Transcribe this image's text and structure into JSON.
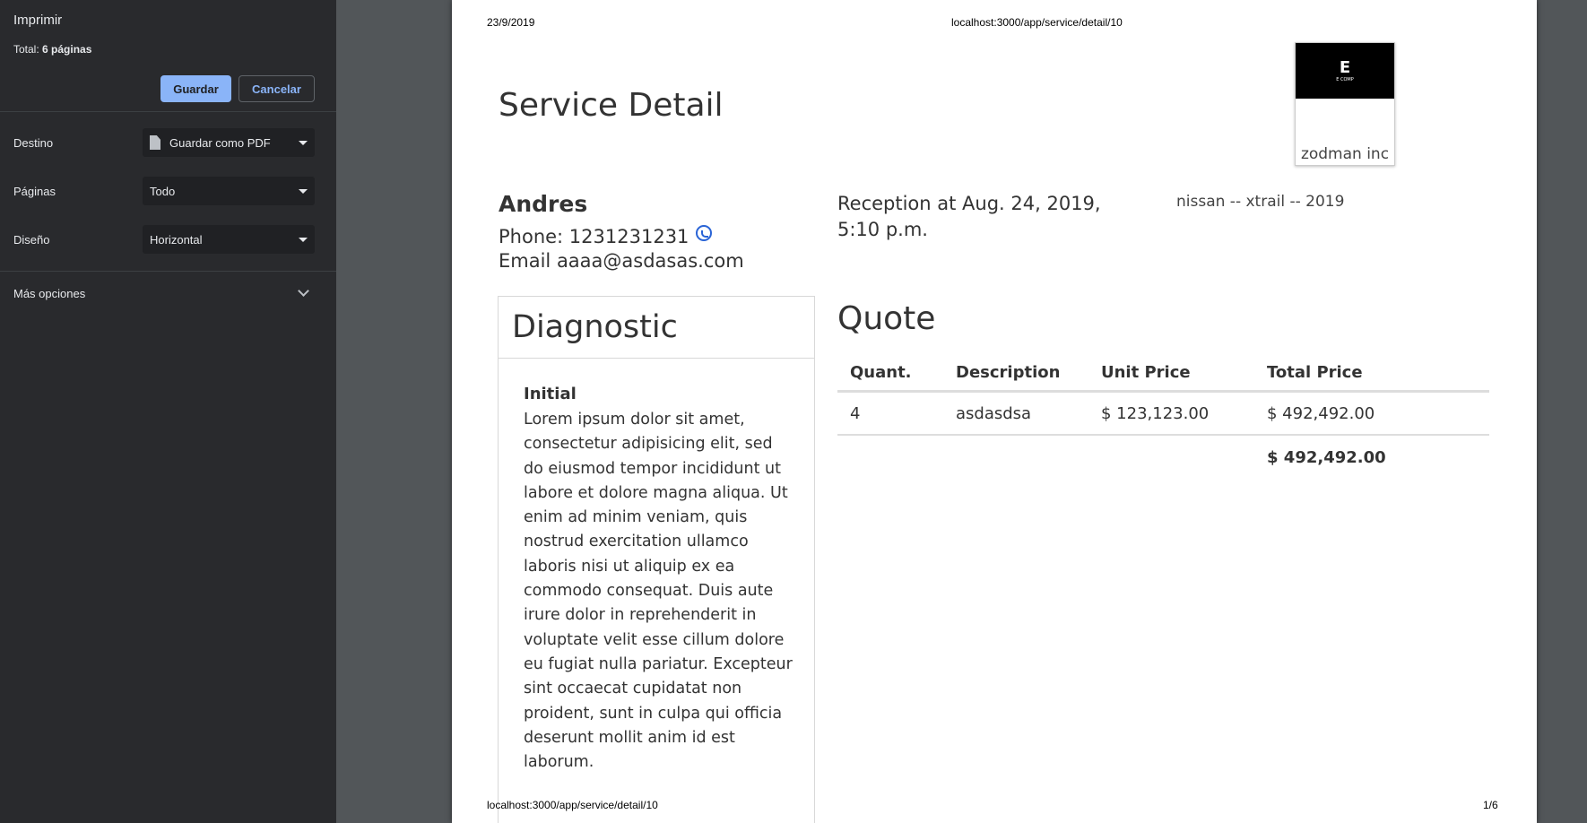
{
  "print_panel": {
    "title": "Imprimir",
    "total_prefix": "Total:",
    "total_pages": "6 páginas",
    "save_label": "Guardar",
    "cancel_label": "Cancelar",
    "destination_label": "Destino",
    "destination_value": "Guardar como PDF",
    "pages_label": "Páginas",
    "pages_value": "Todo",
    "layout_label": "Diseño",
    "layout_value": "Horizontal",
    "more_options_label": "Más opciones"
  },
  "preview": {
    "header_date": "23/9/2019",
    "header_url": "localhost:3000/app/service/detail/10",
    "footer_url": "localhost:3000/app/service/detail/10",
    "footer_page": "1/6",
    "title": "Service Detail",
    "company_name": "zodman inc",
    "logo_text": "E COMP",
    "client": {
      "name": "Andres",
      "phone": "Phone: 1231231231",
      "email": "Email aaaa@asdasas.com"
    },
    "reception": "Reception at Aug. 24, 2019, 5:10 p.m.",
    "vehicle": "nissan -- xtrail -- 2019",
    "diagnostic": {
      "title": "Diagnostic",
      "subtitle": "Initial",
      "text": "Lorem ipsum dolor sit amet, consectetur adipisicing elit, sed do eiusmod tempor incididunt ut labore et dolore magna aliqua. Ut enim ad minim veniam, quis nostrud exercitation ullamco laboris nisi ut aliquip ex ea commodo consequat. Duis aute irure dolor in reprehenderit in voluptate velit esse cillum dolore eu fugiat nulla pariatur. Excepteur sint occaecat cupidatat non proident, sunt in culpa qui officia deserunt mollit anim id est laborum."
    },
    "quote": {
      "title": "Quote",
      "headers": [
        "Quant.",
        "Description",
        "Unit Price",
        "Total Price"
      ],
      "rows": [
        [
          "4",
          "asdasdsa",
          "$ 123,123.00",
          "$ 492,492.00"
        ]
      ],
      "total": "$ 492,492.00"
    }
  },
  "colors": {
    "sidebar_bg": "#292a2d",
    "accent": "#8ab4f8",
    "viewer_bg": "#525659"
  }
}
